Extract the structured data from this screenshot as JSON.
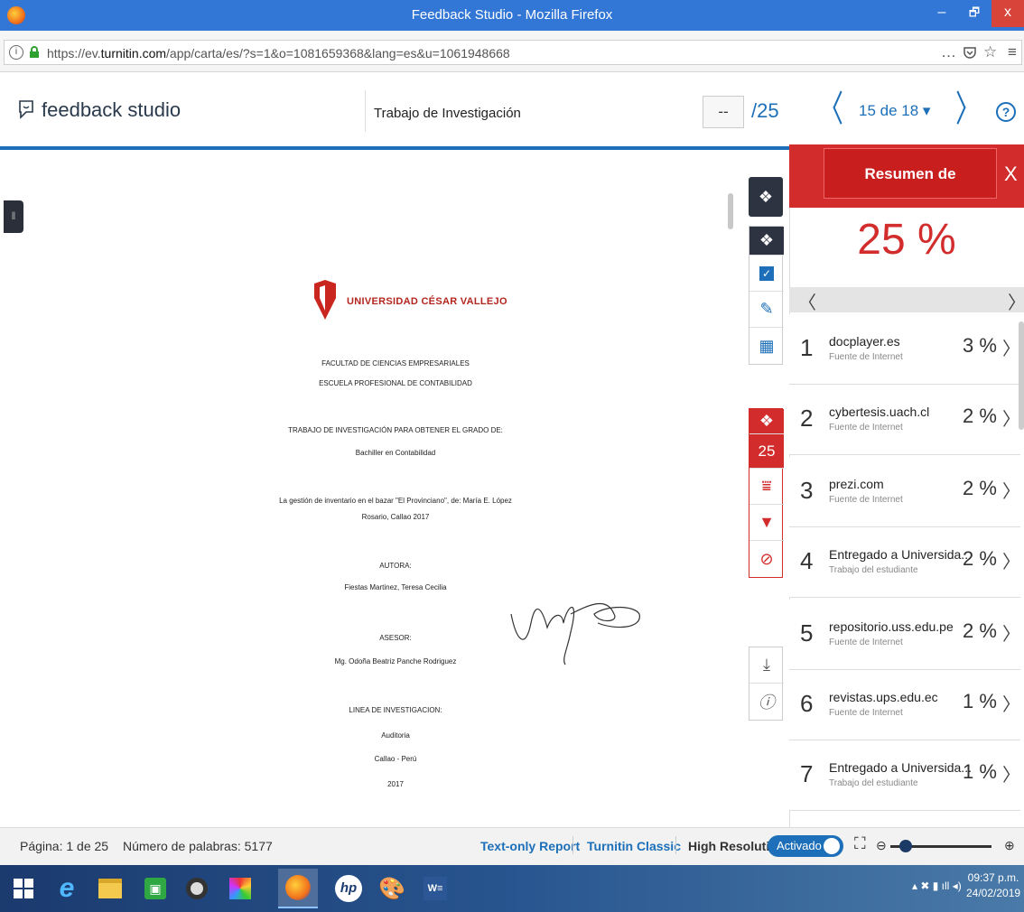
{
  "window": {
    "title": "Feedback Studio - Mozilla Firefox",
    "minimize": "–",
    "maximize": "🗗",
    "close": "x"
  },
  "browser": {
    "url_prefix": "https://ev.",
    "url_domain": "turnitin.com",
    "url_path": "/app/carta/es/?s=1&o=1081659368&lang=es&u=1061948668",
    "menu_icon": "…",
    "hamburger": "≡"
  },
  "header": {
    "brand": "feedback studio",
    "doc_title": "Trabajo de Investigación",
    "grade_value": "--",
    "grade_total": "/25",
    "page_selector": "15 de 18 ▾",
    "prev": "〈",
    "next": "〉",
    "help": "?"
  },
  "document": {
    "university": "UNIVERSIDAD CÉSAR VALLEJO",
    "faculty": "FACULTAD DE CIENCIAS EMPRESARIALES",
    "school": "ESCUELA PROFESIONAL DE CONTABILIDAD",
    "purpose": "TRABAJO DE INVESTIGACIÓN PARA OBTENER EL GRADO DE:",
    "degree": "Bachiller en Contabilidad",
    "title_line1": "La gestión de inventario en el bazar \"El Provinciano\", de: María E. López",
    "title_line2": "Rosario, Callao 2017",
    "author_label": "AUTORA:",
    "author": "Fiestas Martinez, Teresa Cecilia",
    "advisor_label": "ASESOR:",
    "advisor": "Mg. Odoña Beatriz Panche Rodriguez",
    "research_label": "LINEA DE INVESTIGACION:",
    "research_line": "Auditoria",
    "place": "Callao - Perú",
    "year": "2017"
  },
  "tools": {
    "similarity_score": "25"
  },
  "panel": {
    "title": "Resumen de coincidencias",
    "close": "X",
    "overall": "25 %",
    "matches": [
      {
        "n": "1",
        "source": "docplayer.es",
        "type": "Fuente de Internet",
        "pct": "3 %"
      },
      {
        "n": "2",
        "source": "cybertesis.uach.cl",
        "type": "Fuente de Internet",
        "pct": "2 %"
      },
      {
        "n": "3",
        "source": "prezi.com",
        "type": "Fuente de Internet",
        "pct": "2 %"
      },
      {
        "n": "4",
        "source": "Entregado a Universida...",
        "type": "Trabajo del estudiante",
        "pct": "2 %"
      },
      {
        "n": "5",
        "source": "repositorio.uss.edu.pe",
        "type": "Fuente de Internet",
        "pct": "2 %"
      },
      {
        "n": "6",
        "source": "revistas.ups.edu.ec",
        "type": "Fuente de Internet",
        "pct": "1 %"
      },
      {
        "n": "7",
        "source": "Entregado a Universida...",
        "type": "Trabajo del estudiante",
        "pct": "1 %"
      }
    ]
  },
  "status": {
    "page": "Página: 1 de 25",
    "words": "Número de palabras: 5177",
    "text_only": "Text-only Report",
    "classic": "Turnitin Classic",
    "high_res": "High Resolution",
    "toggle": "Activado"
  },
  "taskbar": {
    "time": "09:37 p.m.",
    "date": "24/02/2019"
  }
}
